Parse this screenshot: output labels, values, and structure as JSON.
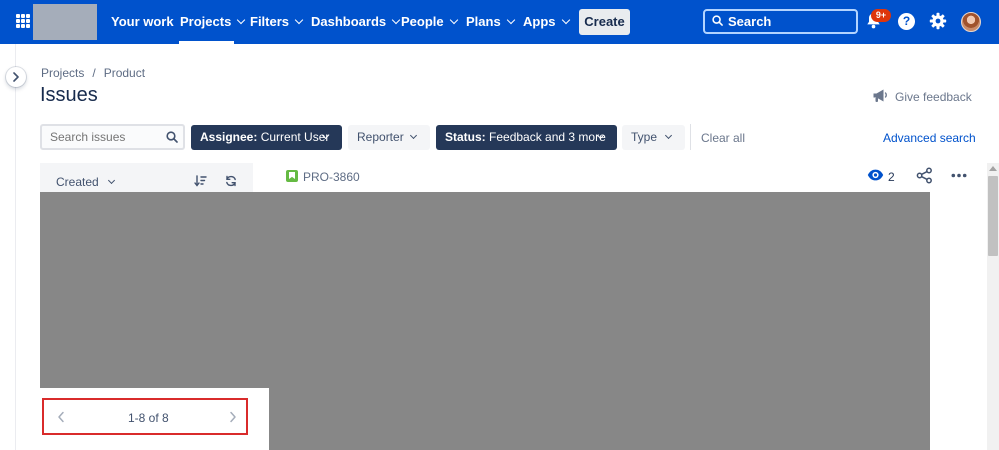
{
  "topnav": {
    "items": [
      {
        "label": "Your work",
        "dropdown": false
      },
      {
        "label": "Projects",
        "dropdown": true,
        "active": true
      },
      {
        "label": "Filters",
        "dropdown": true
      },
      {
        "label": "Dashboards",
        "dropdown": true
      },
      {
        "label": "People",
        "dropdown": true
      },
      {
        "label": "Plans",
        "dropdown": true
      },
      {
        "label": "Apps",
        "dropdown": true
      }
    ],
    "create_label": "Create",
    "search_label": "Search",
    "notification_badge": "9+",
    "help_glyph": "?",
    "icons": [
      "apps-grid-icon",
      "search-icon",
      "bell-icon",
      "help-icon",
      "gear-icon",
      "avatar"
    ],
    "colors": {
      "bar": "#0052cc",
      "badge": "#de350b"
    }
  },
  "breadcrumb": {
    "items": [
      "Projects",
      "Product"
    ],
    "separator": "/"
  },
  "page_title": "Issues",
  "feedback_label": "Give feedback",
  "filters": {
    "search_placeholder": "Search issues",
    "chips": [
      {
        "key": "Assignee:",
        "value": "Current User",
        "style": "dark"
      },
      {
        "key": "",
        "value": "Reporter",
        "style": "light"
      },
      {
        "key": "Status:",
        "value": "Feedback and 3 more",
        "style": "dark"
      },
      {
        "key": "",
        "value": "Type",
        "style": "light"
      }
    ],
    "clear_all": "Clear all",
    "advanced_search": "Advanced search"
  },
  "list": {
    "sort_label": "Created",
    "pagination": "1-8 of 8"
  },
  "detail": {
    "issue_key": "PRO-3860",
    "watch_count": "2"
  }
}
